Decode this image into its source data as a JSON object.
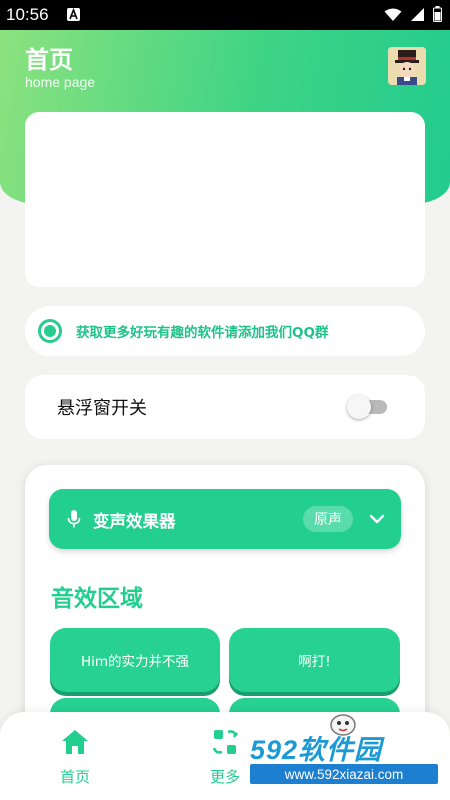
{
  "status_bar": {
    "time": "10:56",
    "icons": [
      "notification-a-icon",
      "wifi-icon",
      "signal-icon",
      "battery-icon"
    ]
  },
  "header": {
    "title": "首页",
    "subtitle": "home page",
    "gradient_colors": [
      "#8ce27e",
      "#22cb8e"
    ]
  },
  "notice": {
    "text": "获取更多好玩有趣的软件请添加我们QQ群"
  },
  "floating_window": {
    "label": "悬浮窗开关",
    "enabled": false
  },
  "voice_changer": {
    "title": "变声效果器",
    "selected_mode": "原声"
  },
  "effects": {
    "section_title": "音效区域",
    "buttons": [
      {
        "label": "Him的实力并不强"
      },
      {
        "label": "啊打!"
      },
      {
        "label": ""
      },
      {
        "label": ""
      }
    ]
  },
  "bottom_nav": {
    "items": [
      {
        "label": "首页",
        "icon": "home-icon"
      },
      {
        "label": "更多",
        "icon": "grid-refresh-icon"
      }
    ]
  },
  "watermark": {
    "brand": "592软件园",
    "url": "www.592xiazai.com"
  },
  "colors": {
    "accent": "#22cf8f",
    "background": "#f3f3f1"
  }
}
